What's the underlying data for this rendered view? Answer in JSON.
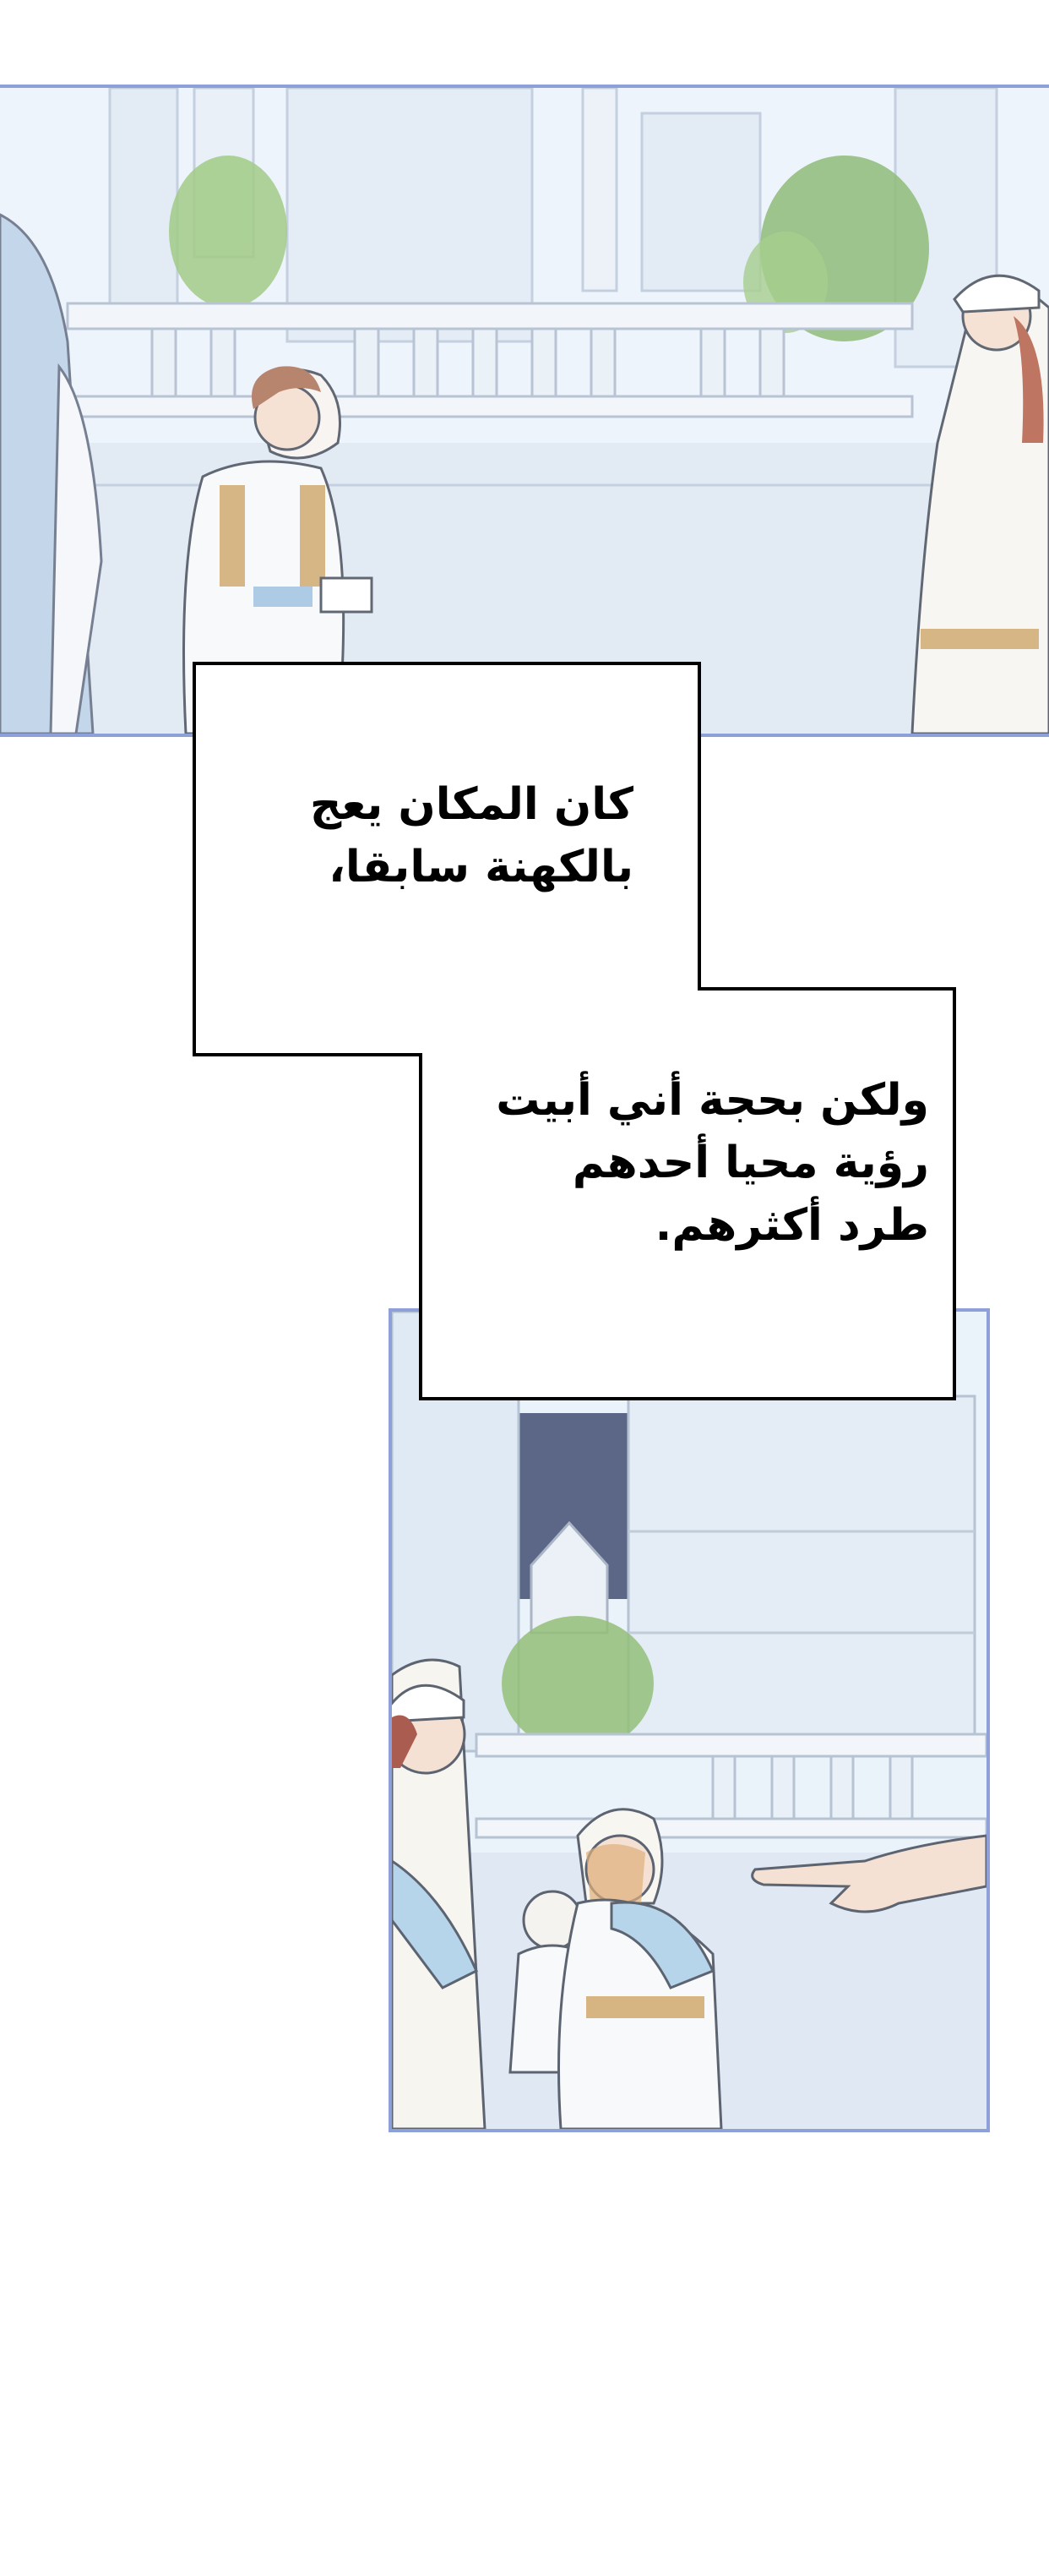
{
  "panels": [
    {
      "name": "courtyard-panel",
      "scene": "palace-courtyard"
    },
    {
      "name": "priests-panel",
      "scene": "palace-courtyard-closeup"
    }
  ],
  "caption": {
    "line1": "كان المكان يعج",
    "line2": "بالكهنة سابقا،",
    "line3": "ولكن بحجة أني أبيت",
    "line4": "رؤية محيا أحدهم",
    "line5": "طرد أكثرهم."
  },
  "colors": {
    "panel_border": "#8ea0d8",
    "sky": "#eaf3fb",
    "stone": "#dfe9f4",
    "foliage": "#7fb35f",
    "text": "#000000"
  }
}
